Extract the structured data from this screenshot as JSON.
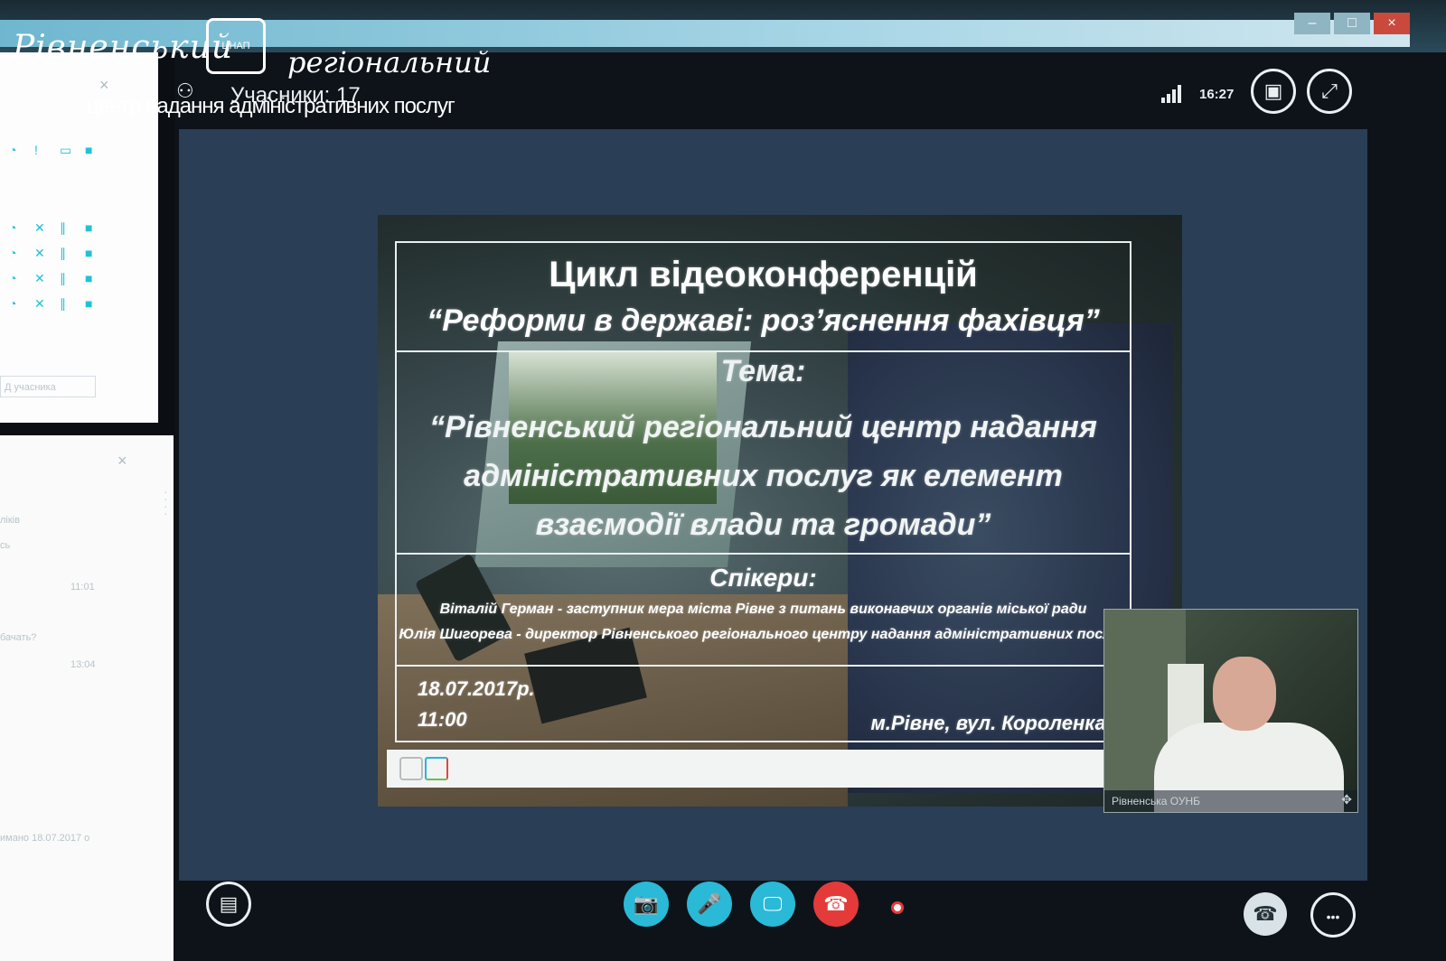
{
  "window": {
    "minimize": "–",
    "maximize": "□",
    "close": "×"
  },
  "logo": {
    "script_left": "Рівненський",
    "script_right": "регіональний",
    "badge": "ЦНАП",
    "subtitle": "центр надання адміністративних послуг"
  },
  "header": {
    "participants_label": "Учасники: 17",
    "time": "16:27",
    "layout_icon": "layout-switch-icon",
    "fullscreen_icon": "fullscreen-icon"
  },
  "left_panel": {
    "close": "×",
    "add_participant_placeholder": "Д учасника",
    "chat_close": "×",
    "chat_lines": [
      "ліків",
      "сь",
      "11:01",
      "бачать?",
      "13:04",
      "имано 18.07.2017 о"
    ]
  },
  "slide": {
    "title": "Цикл відеоконференцій",
    "subtitle": "“Реформи в державі: роз’яснення фахівця”",
    "topic_label": "Тема:",
    "topic_line1": "“Рівненський регіональний центр надання",
    "topic_line2": "адміністративних послуг як елемент",
    "topic_line3": "взаємодії влади та громади”",
    "speakers_label": "Спікери:",
    "speaker1": "Віталій Герман - заступник мера міста Рівне з питань виконавчих органів міської ради",
    "speaker2": "Юлія Шигорева - директор Рівненського регіонального центру надання адміністративних послуг",
    "date": "18.07.2017р.",
    "time": "11:00",
    "address": "м.Рівне, вул. Короленка,"
  },
  "webcam": {
    "label": "Рівненська ОУНБ",
    "move_icon": "✥"
  },
  "controls": {
    "chat": "💬",
    "video": "📷",
    "mic": "🎤",
    "share": "🖵",
    "hangup": "☎",
    "dial": "☎",
    "more": "•••"
  },
  "colors": {
    "accent": "#2ab9d6",
    "hangup": "#e43a3a",
    "stage": "#2a3e55"
  }
}
